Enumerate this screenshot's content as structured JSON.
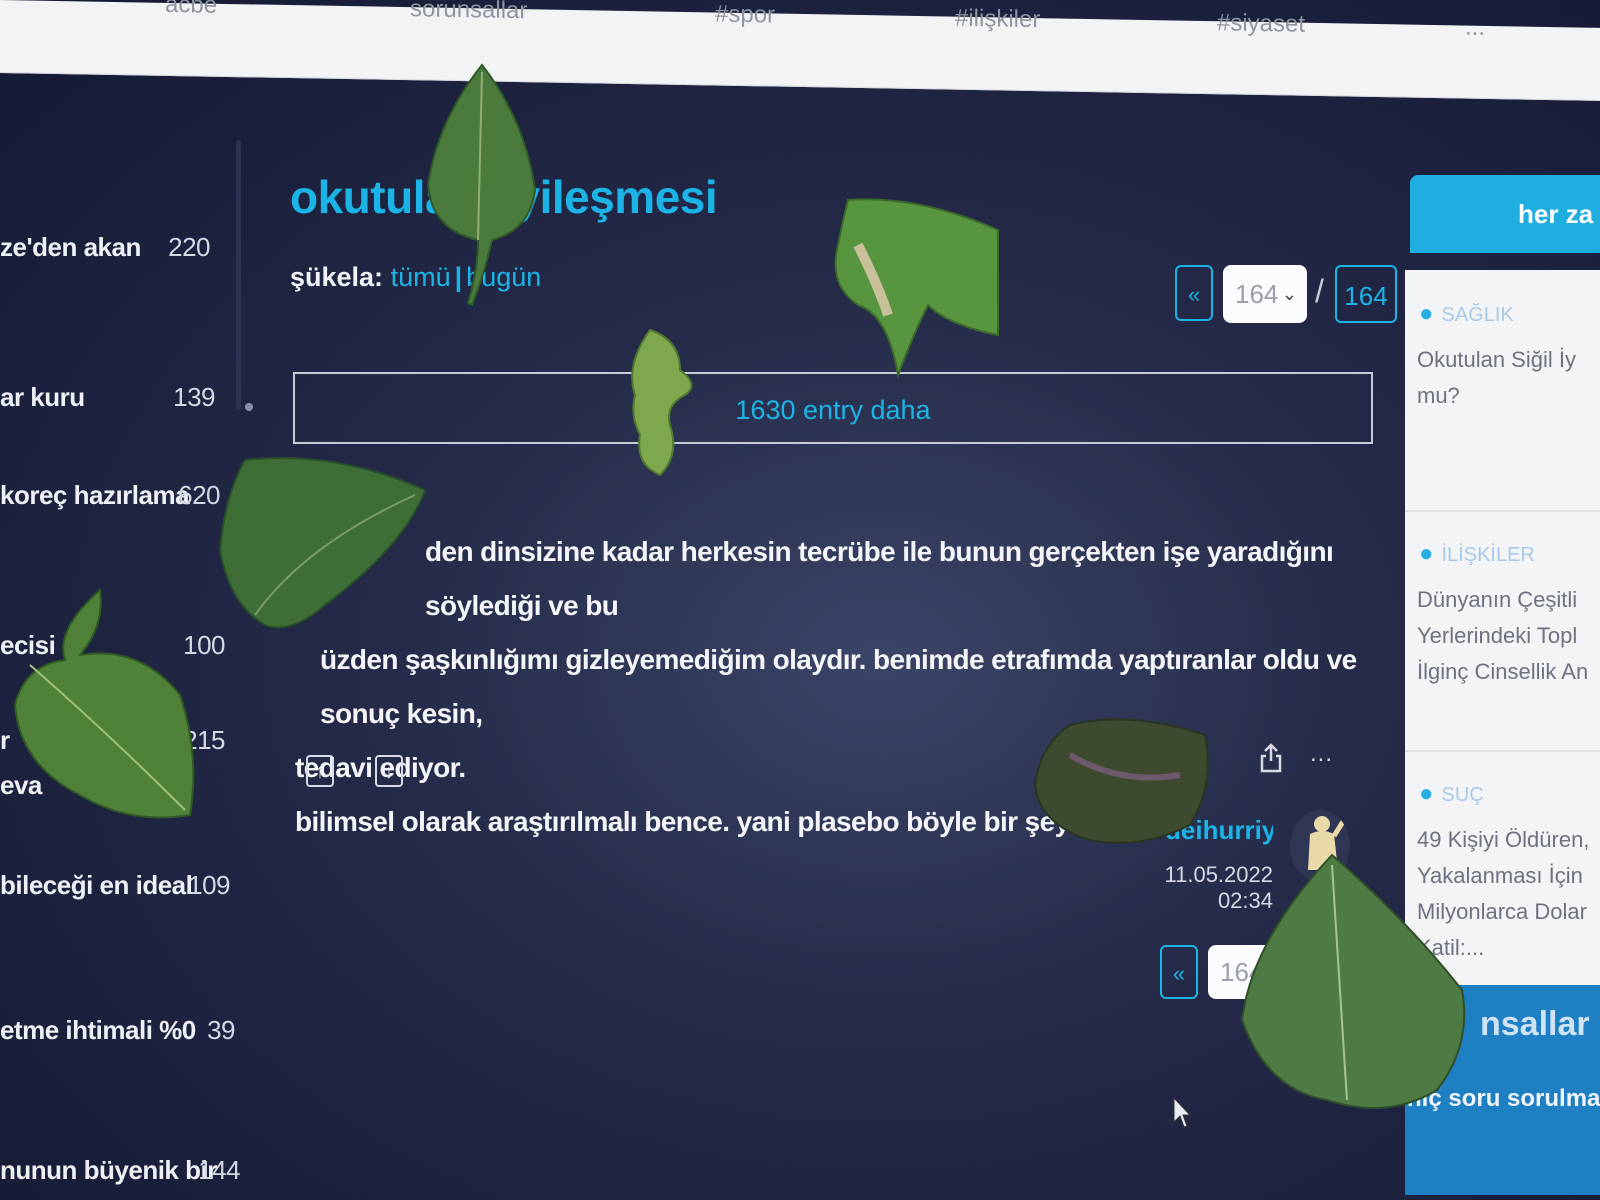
{
  "nav": {
    "items": [
      "acbe",
      "sorunsallar",
      "#spor",
      "#ilişkiler",
      "#siyaset",
      "..."
    ]
  },
  "sidebar": {
    "items": [
      {
        "title": "ze'den akan",
        "count": "220"
      },
      {
        "title": "ar kuru",
        "count": "139"
      },
      {
        "title": "koreç hazırlama",
        "count": "620"
      },
      {
        "title": "ecisi",
        "count": "100"
      },
      {
        "title": "r",
        "count": "215"
      },
      {
        "title": "eva",
        "count": ""
      },
      {
        "title": "bileceği en ideal",
        "count": "109"
      },
      {
        "title": "etme ihtimali %0",
        "count": "39"
      },
      {
        "title": "nunun büyenik bir",
        "count": "144"
      }
    ]
  },
  "topic": {
    "title": "okutula n iyileşmesi",
    "sukela_label": "şükela:",
    "filter_all": "tümü",
    "filter_sep": "|",
    "filter_today": "bugün"
  },
  "pager": {
    "prev": "«",
    "current": "164",
    "slash": "/",
    "last": "164"
  },
  "more_entries": "1630 entry daha",
  "entry": {
    "lines": [
      "den dinsizine kadar herkesin tecrübe ile bunun gerçekten işe yaradığını söylediği ve bu",
      "üzden şaşkınlığımı gizleyemediğim olaydır. benimde etrafımda yaptıranlar oldu ve sonuç kesin,",
      "tedavi ediyor.",
      "bilimsel olarak araştırılmalı bence. yani plasebo böyle bir şey değil."
    ],
    "author": "deihurriyet",
    "date": "11.05.2022 02:34",
    "more": "..."
  },
  "pager_bottom": {
    "prev": "«",
    "current": "164"
  },
  "rightbar": {
    "button": "her za",
    "cards": [
      {
        "category": "SAĞLIK",
        "text": "Okutulan Siğil İy\nmu?"
      },
      {
        "category": "İLİŞKİLER",
        "text": "Dünyanın Çeşitli\nYerlerindeki Topl\nİlginç Cinsellik An"
      },
      {
        "category": "SUÇ",
        "text": "49 Kişiyi Öldüren,\nYakalanması İçin\nMilyonlarca Dolar\n   Katil:..."
      }
    ],
    "bottom_title": "nsallar",
    "bottom_sub": "hiç soru sorulmam"
  },
  "colors": {
    "accent": "#1cb4e6",
    "background": "#242a48",
    "leaf": "#4a7a3c"
  }
}
